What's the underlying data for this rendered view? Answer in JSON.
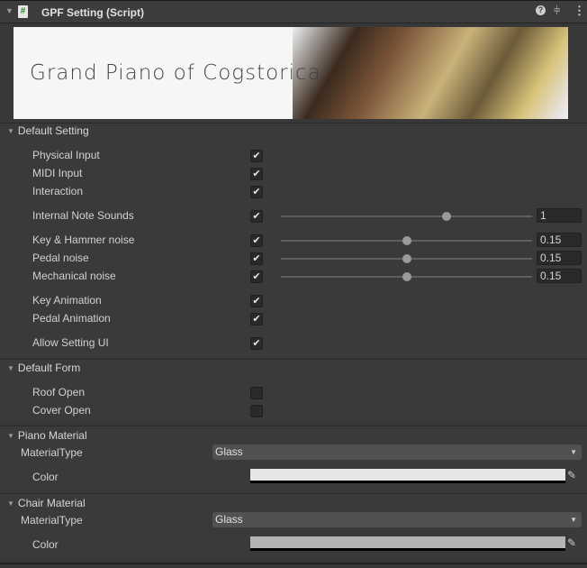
{
  "header": {
    "title": "GPF Setting (Script)",
    "script_icon": "#",
    "icons": [
      "help-icon",
      "preset-icon",
      "kebab-menu-icon"
    ]
  },
  "banner": {
    "text": "Grand Piano of Cogstorica"
  },
  "default_setting": {
    "title": "Default Setting",
    "rows": [
      {
        "label": "Physical Input",
        "checked": true
      },
      {
        "label": "MIDI Input",
        "checked": true
      },
      {
        "label": "Interaction",
        "checked": true
      },
      {
        "label": "Internal Note Sounds",
        "checked": true,
        "slider_fraction": 0.66,
        "value": "1"
      },
      {
        "label": "Key & Hammer noise",
        "checked": true,
        "slider_fraction": 0.5,
        "value": "0.15"
      },
      {
        "label": "Pedal noise",
        "checked": true,
        "slider_fraction": 0.5,
        "value": "0.15"
      },
      {
        "label": "Mechanical noise",
        "checked": true,
        "slider_fraction": 0.5,
        "value": "0.15"
      },
      {
        "label": "Key Animation",
        "checked": true
      },
      {
        "label": "Pedal Animation",
        "checked": true
      },
      {
        "label": "Allow Setting UI",
        "checked": true
      }
    ]
  },
  "default_form": {
    "title": "Default Form",
    "rows": [
      {
        "label": "Roof Open",
        "checked": false
      },
      {
        "label": "Cover Open",
        "checked": false
      }
    ]
  },
  "piano_material": {
    "title": "Piano Material",
    "type_label": "MaterialType",
    "type_value": "Glass",
    "color_label": "Color",
    "color": "#e6e6e6"
  },
  "chair_material": {
    "title": "Chair Material",
    "type_label": "MaterialType",
    "type_value": "Glass",
    "color_label": "Color",
    "color": "#b4b4b4"
  },
  "check_glyph": "✔"
}
